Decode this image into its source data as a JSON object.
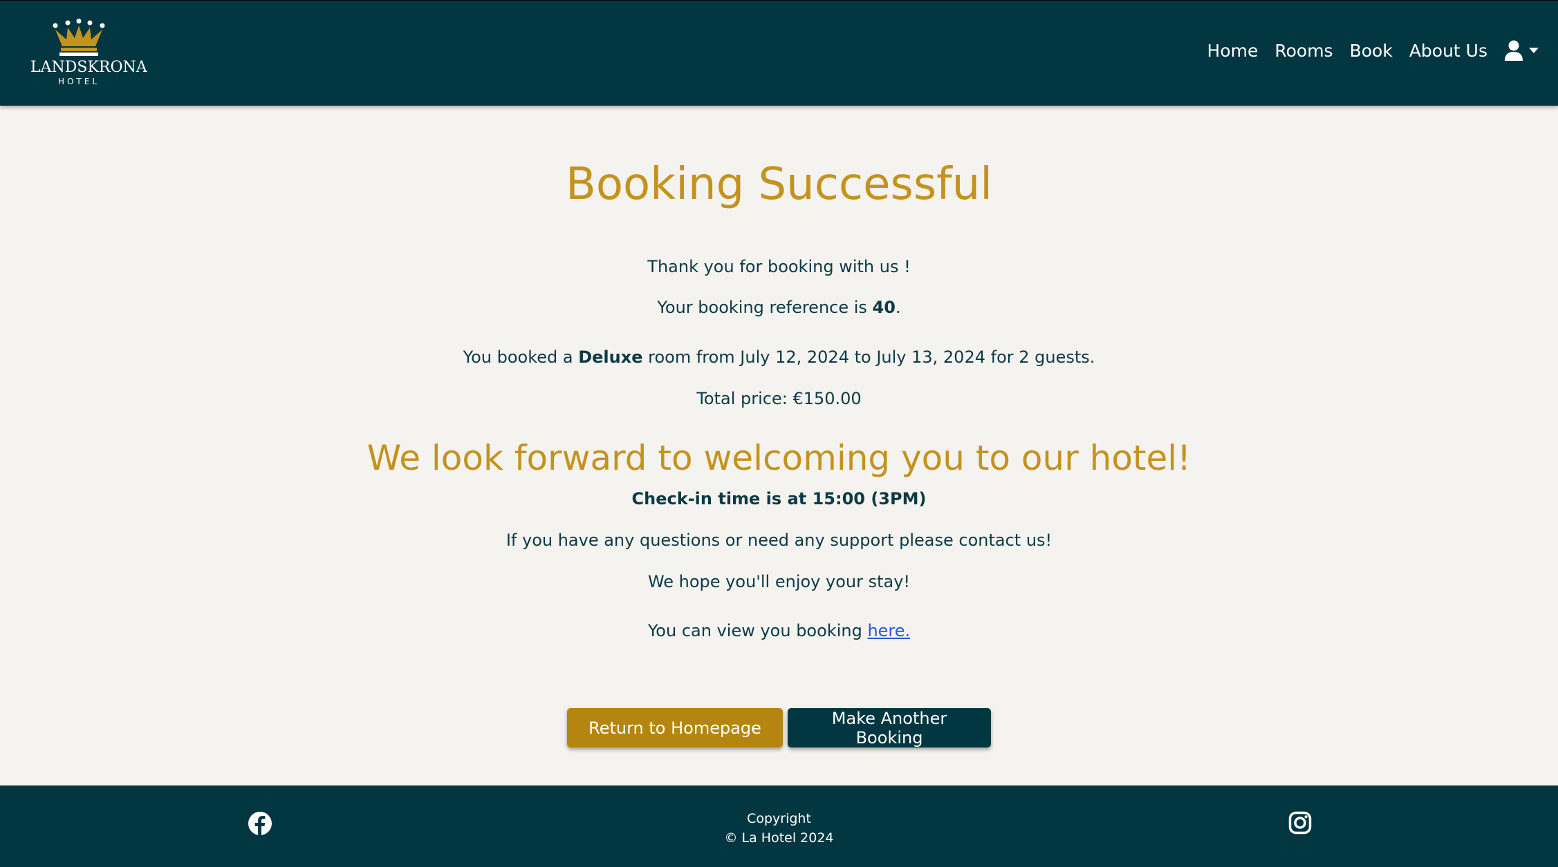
{
  "brand": {
    "logo_name": "LANDSKRONA",
    "logo_sub": "HOTEL"
  },
  "nav": {
    "items": [
      {
        "label": "Home"
      },
      {
        "label": "Rooms"
      },
      {
        "label": "Book"
      },
      {
        "label": "About Us"
      }
    ],
    "user_icon": "user-icon",
    "caret_icon": "caret-down-icon"
  },
  "main": {
    "title": "Booking Successful",
    "thanks": "Thank you for booking with us !",
    "reference_prefix": "Your booking reference is ",
    "reference_number": "40",
    "reference_suffix": ".",
    "booked_prefix": "You booked a ",
    "room_type": "Deluxe",
    "booked_suffix": " room from July 12, 2024 to July 13, 2024 for 2 guests.",
    "total_price": "Total price: €150.00",
    "welcome": "We look forward to welcoming you to our hotel!",
    "checkin": "Check-in time is at 15:00 (3PM)",
    "support": "If you have any questions or need any support please contact us!",
    "enjoy": "We hope you'll enjoy your stay!",
    "view_prefix": "You can view you booking ",
    "view_link": "here."
  },
  "buttons": {
    "home": "Return to Homepage",
    "another": "Make Another Booking"
  },
  "footer": {
    "copyright_label": "Copyright",
    "copyright_text": "© La Hotel 2024",
    "facebook_icon": "facebook-icon",
    "instagram_icon": "instagram-icon"
  },
  "colors": {
    "primary_dark": "#023741",
    "gold": "#c4921e",
    "button_gold": "#b5860f",
    "background": "#f5f3ef",
    "link": "#2459d6"
  }
}
